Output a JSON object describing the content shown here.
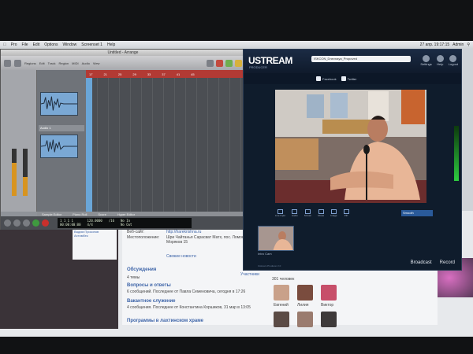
{
  "menubar": {
    "items": [
      "Pro",
      "File",
      "Edit",
      "Options",
      "Window",
      "Screenset 1",
      "Help"
    ],
    "clock": "27 апр. 19:17:15",
    "user": "Admin"
  },
  "daw": {
    "window_title": "Untitled - Arrange",
    "toolbar_labels": [
      "Regions",
      "Edit",
      "Track",
      "Region",
      "MIDI",
      "Audio",
      "View"
    ],
    "region_label": "Audio 1",
    "tabs": [
      "Sample Editor",
      "Piano Roll",
      "Score",
      "Hyper Editor"
    ],
    "lcd": {
      "pos1": "1  1  1  1",
      "pos2": "00:00:00:00",
      "tempo": "120.0000",
      "sig": "4/4",
      "division": "/16",
      "in": "No In",
      "out": "No Out"
    }
  },
  "ustream": {
    "logo": "USTREAM",
    "sublabel": "PRODUCER",
    "url": "ISKCON_Dnevnaya_Propoved",
    "header_icons": [
      "Settings",
      "Help",
      "Logout"
    ],
    "share_tags": [
      "Facebook",
      "Twitter"
    ],
    "toolbar_items": [
      "Live Input",
      "Audio",
      "Screen",
      "Movie",
      "Image",
      "PiP"
    ],
    "dropdown": "Smooth",
    "thumb_label": "Intro Cam",
    "broadcast": "Broadcast",
    "record": "Record",
    "footer_small": "Ustream Producer 2.0"
  },
  "webpage": {
    "site_label": "Веб-сайт:",
    "site_value": "http://harekrishna.ru",
    "location_label": "Местоположение:",
    "location_value": "Шри Чайтанья Сарасват Матх, пос. Ломоносов, ул. Моряков 15",
    "left_links": [
      "Вадим Прокопов",
      "Ахтимбек"
    ],
    "section": "Обсуждения",
    "topics_count": "4 темы",
    "topics": [
      {
        "title": "Вопросы и ответы",
        "meta": "6 сообщений. Последнее от Павла Семеновича, сегодня в 17:26"
      },
      {
        "title": "Вакантное служение",
        "meta": "4 сообщения. Последнее от Константина Коршиков, 31 мар в 13:05"
      },
      {
        "title": "Программы в лахтинском храме",
        "meta": ""
      }
    ],
    "fresh_news": "Свежие новости",
    "members_label": "Участники",
    "members_count": "301 человек",
    "members": [
      "Евгений",
      "Лилия",
      "Виктор"
    ]
  },
  "colors": {
    "ustream_bg": "#0f1c2c",
    "ruler_red": "#b23a34",
    "region_blue": "#7aa8d4",
    "record_red": "#c9302c"
  }
}
